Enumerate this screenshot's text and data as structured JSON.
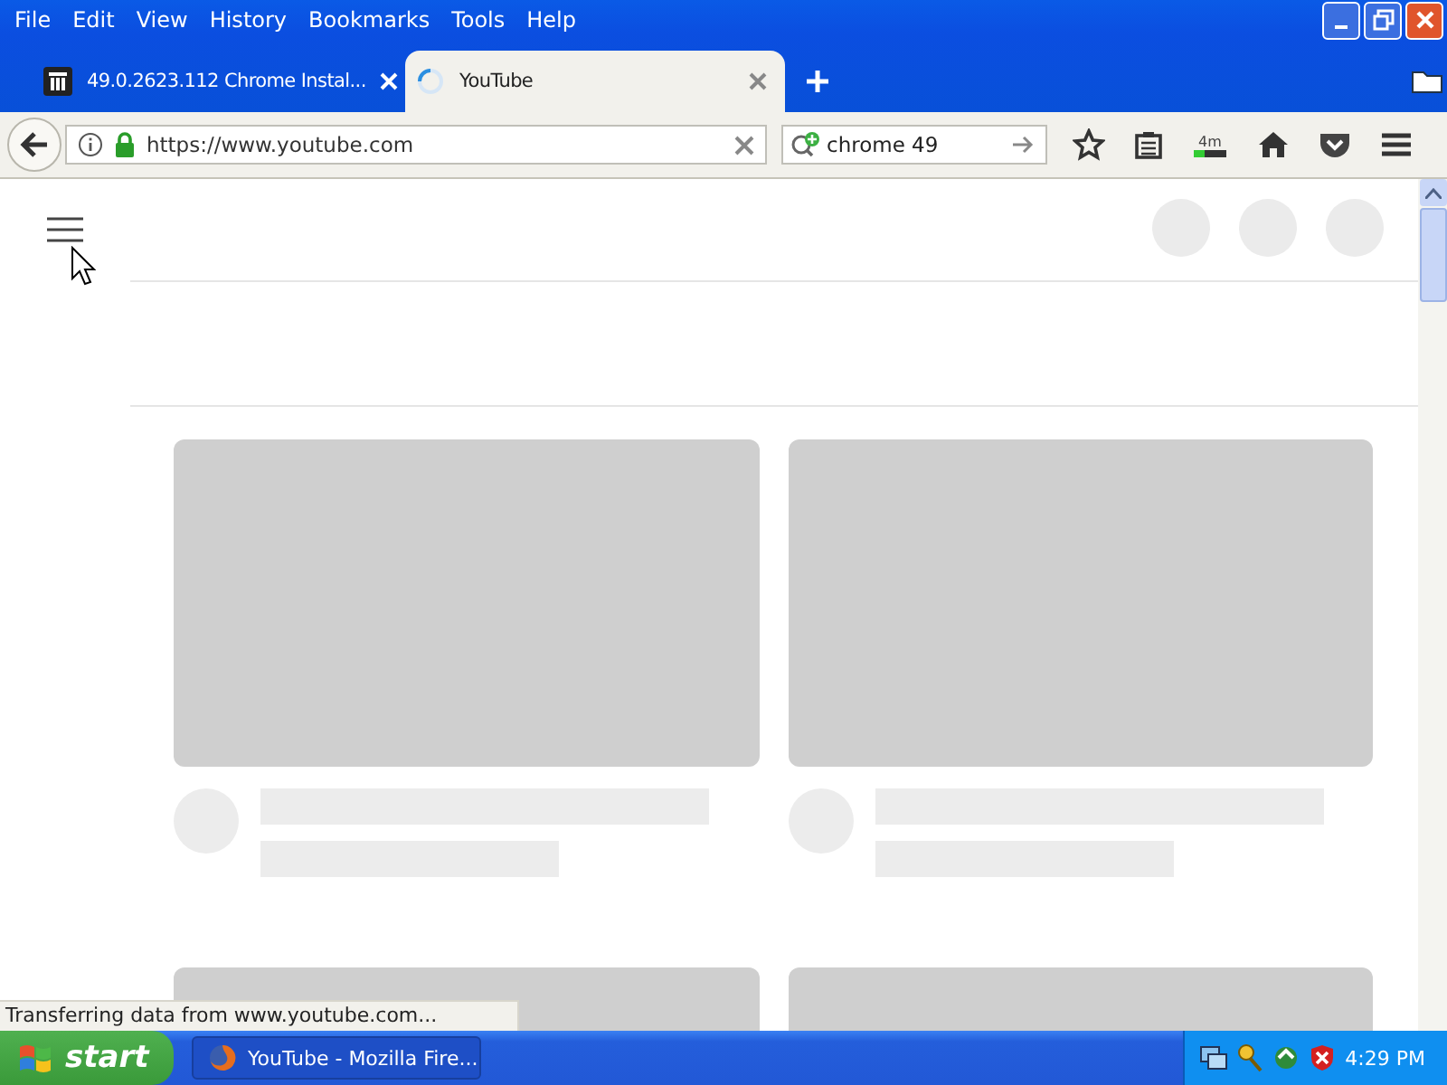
{
  "window": {
    "menu": [
      "File",
      "Edit",
      "View",
      "History",
      "Bookmarks",
      "Tools",
      "Help"
    ]
  },
  "tabs": [
    {
      "title": "49.0.2623.112 Chrome Instal...",
      "selected": false,
      "kind": "archive"
    },
    {
      "title": "YouTube",
      "selected": true,
      "kind": "loading"
    }
  ],
  "navigation": {
    "address": "https://www.youtube.com",
    "search": "chrome 49",
    "download_badge": "4m"
  },
  "page": {
    "video_placeholders": [
      {
        "kind": "placeholder"
      },
      {
        "kind": "placeholder"
      },
      {
        "kind": "thumbnail_only"
      },
      {
        "kind": "thumbnail_only"
      }
    ]
  },
  "status_bar": "Transferring data from www.youtube.com...",
  "taskbar": {
    "start": "start",
    "task": "YouTube - Mozilla Fire...",
    "clock": "4:29 PM"
  }
}
